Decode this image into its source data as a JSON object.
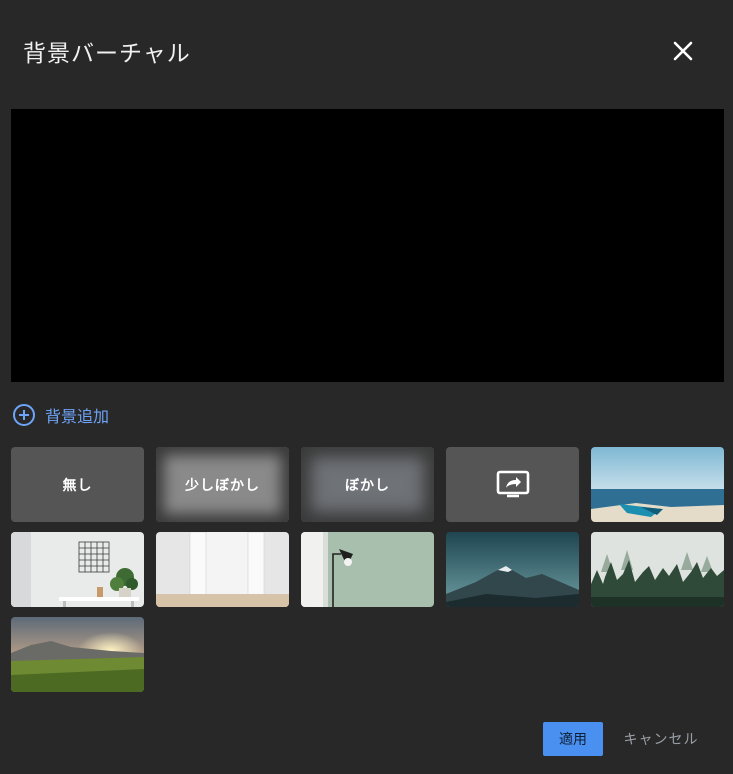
{
  "dialog": {
    "title": "背景バーチャル",
    "close_icon": "close-icon"
  },
  "add_background": {
    "icon": "add-circle-icon",
    "label": "背景追加",
    "color": "#6ea4f7"
  },
  "options": {
    "none_label": "無し",
    "slight_blur_label": "少しぼかし",
    "blur_label": "ぼかし",
    "share_icon": "screen-share-icon"
  },
  "backgrounds": [
    {
      "name": "beach-boat"
    },
    {
      "name": "white-room-plant"
    },
    {
      "name": "white-doors"
    },
    {
      "name": "floor-lamp"
    },
    {
      "name": "mountain-peak"
    },
    {
      "name": "foggy-forest"
    },
    {
      "name": "sunset-meadow"
    }
  ],
  "footer": {
    "apply_label": "適用",
    "cancel_label": "キャンセル",
    "accent": "#4a90f0"
  }
}
